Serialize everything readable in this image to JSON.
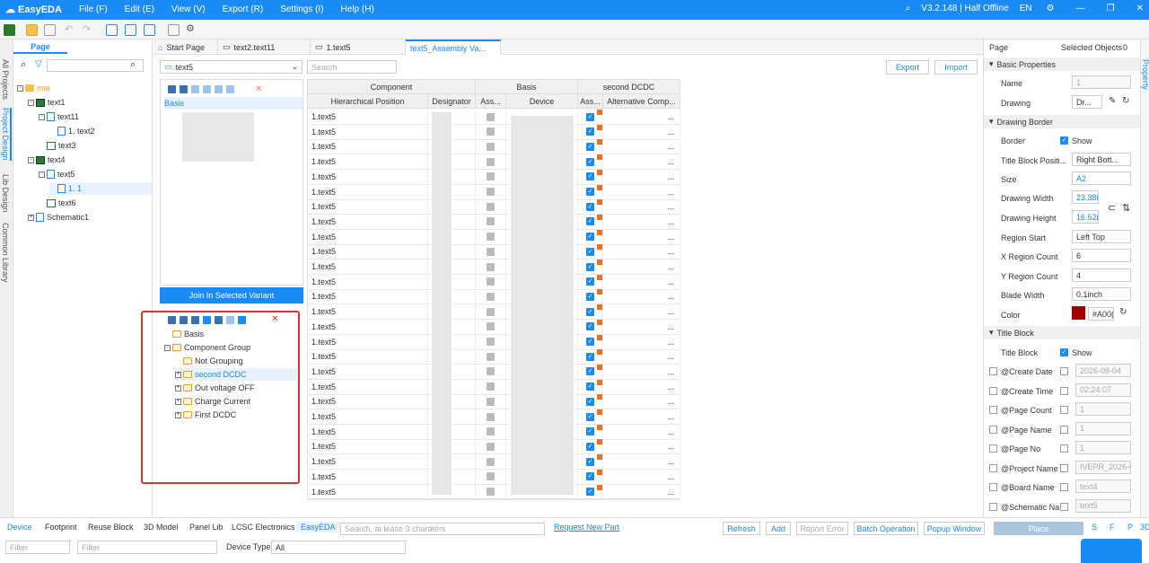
{
  "app": {
    "name": "EasyEDA",
    "menu": [
      "File (F)",
      "Edit (E)",
      "View (V)",
      "Export (R)",
      "Settings (I)",
      "Help (H)"
    ],
    "version": "V3.2.148 | Half Offline",
    "lang": "EN"
  },
  "left_tabs": [
    "All Projects",
    "Project Design",
    "Lib Design",
    "Common Library"
  ],
  "page_panel": {
    "tab": "Page",
    "tree": [
      {
        "label": "mai",
        "indent": 0,
        "icon": "folder",
        "pm": "-",
        "selected": false
      },
      {
        "label": "text1",
        "indent": 1,
        "icon": "pcb",
        "pm": "-",
        "selected": false
      },
      {
        "label": "text11",
        "indent": 2,
        "icon": "doc",
        "pm": "-",
        "selected": false
      },
      {
        "label": "1. text2",
        "indent": 3,
        "icon": "doc",
        "pm": "",
        "selected": false
      },
      {
        "label": "text3",
        "indent": 2,
        "icon": "sch",
        "pm": "",
        "selected": false
      },
      {
        "label": "text4",
        "indent": 1,
        "icon": "pcb",
        "pm": "-",
        "selected": false
      },
      {
        "label": "text5",
        "indent": 2,
        "icon": "doc",
        "pm": "-",
        "selected": false
      },
      {
        "label": "1. 1",
        "indent": 3,
        "icon": "doc",
        "pm": "",
        "selected": true
      },
      {
        "label": "text6",
        "indent": 2,
        "icon": "sch",
        "pm": "",
        "selected": false
      },
      {
        "label": "Schematic1",
        "indent": 1,
        "icon": "doc",
        "pm": "+",
        "selected": false
      }
    ]
  },
  "doc_tabs": [
    {
      "label": "Start Page",
      "active": false
    },
    {
      "label": "text2.text11",
      "active": false
    },
    {
      "label": "1.text5",
      "active": false
    },
    {
      "label": "text5_Assembly Va...",
      "active": true
    }
  ],
  "variant": {
    "select": "text5",
    "search_placeholder": "Search",
    "export_label": "Export",
    "import_label": "Import",
    "top_list_first": "Basis",
    "join_label": "Join In Selected Variant",
    "groups": [
      {
        "label": "Basis",
        "indent": 0,
        "pm": "",
        "selected": false
      },
      {
        "label": "Component Group",
        "indent": 0,
        "pm": "-",
        "selected": false
      },
      {
        "label": "Not Grouping",
        "indent": 1,
        "pm": "",
        "selected": false
      },
      {
        "label": "second DCDC",
        "indent": 1,
        "pm": "+",
        "selected": true
      },
      {
        "label": "Out voltage OFF",
        "indent": 1,
        "pm": "+",
        "selected": false
      },
      {
        "label": "Charge Current",
        "indent": 1,
        "pm": "+",
        "selected": false
      },
      {
        "label": "First DCDC",
        "indent": 1,
        "pm": "+",
        "selected": false
      }
    ]
  },
  "grid": {
    "groups": [
      "Component",
      "Basis",
      "second DCDC"
    ],
    "columns": [
      "Hierarchical Position",
      "Designator",
      "Ass...",
      "Device",
      "Ass...",
      "Alternative Comp..."
    ],
    "cell_value": "1.text5",
    "more": "...",
    "row_count": 26
  },
  "property": {
    "tabs": [
      "Page",
      "Selected Objects"
    ],
    "selected_count": "0",
    "basic_title": "Basic Properties",
    "name_label": "Name",
    "name_value": "1",
    "drawing_label": "Drawing",
    "drawing_value": "Dr...",
    "border_title": "Drawing Border",
    "border_label": "Border",
    "border_show": "Show",
    "tb_pos_label": "Title Block Positi...",
    "tb_pos_value": "Right Bott...",
    "size_label": "Size",
    "size_value": "A2",
    "width_label": "Drawing Width",
    "width_value": "23.38i",
    "height_label": "Drawing Height",
    "height_value": "16.52i",
    "region_label": "Region Start",
    "region_value": "Left Top",
    "xcount_label": "X Region Count",
    "xcount_value": "6",
    "ycount_label": "Y Region Count",
    "ycount_value": "4",
    "blade_label": "Blade Width",
    "blade_value": "0.1inch",
    "color_label": "Color",
    "color_value": "#A00(",
    "color_hex": "#a00000",
    "title_block_title": "Title Block",
    "title_block_label": "Title Block",
    "title_block_show": "Show",
    "fields": [
      {
        "label": "@Create Date",
        "value": "2026-08-04"
      },
      {
        "label": "@Create Time",
        "value": "02:24:07"
      },
      {
        "label": "@Page Count",
        "value": "1"
      },
      {
        "label": "@Page Name",
        "value": "1"
      },
      {
        "label": "@Page No",
        "value": "1"
      },
      {
        "label": "@Project Name",
        "value": "IVEPR_2026-0("
      },
      {
        "label": "@Board Name",
        "value": "text4"
      },
      {
        "label": "@Schematic Na...",
        "value": "text5"
      }
    ],
    "side_tab": "Property"
  },
  "bottom": {
    "tabs": [
      "Device",
      "Footprint",
      "Reuse Block",
      "3D Model",
      "Panel Lib",
      "LCSC Electronics",
      "EasyEDA"
    ],
    "search_placeholder": "Search, at lease 3 charaters",
    "request": "Request New Part",
    "refresh": "Refresh",
    "add": "Add",
    "report": "Report Error",
    "batch": "Batch Operation",
    "popup": "Popup Window",
    "place": "Place",
    "sfp": [
      "S",
      "F",
      "P",
      "3D"
    ],
    "filter": "Filter",
    "device_type_label": "Device Type",
    "device_type_value": "All"
  }
}
